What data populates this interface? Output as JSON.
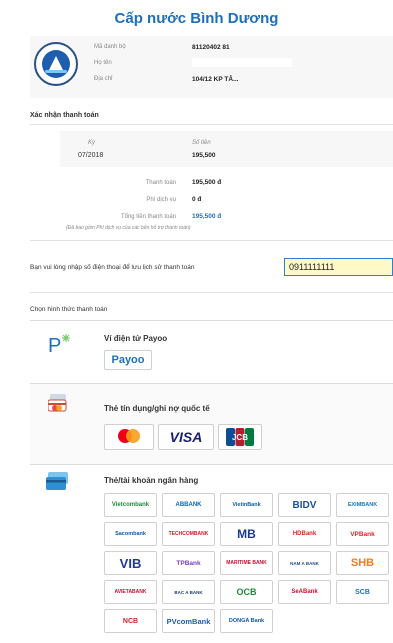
{
  "header": {
    "title": "Cấp nước Bình Dương"
  },
  "customer": {
    "code_label": "Mã danh bộ",
    "code_value": "81120402 81",
    "name_label": "Họ tên",
    "name_value": "",
    "address_label": "Địa chỉ",
    "address_value": "104/12 KP TÂ..."
  },
  "confirm": {
    "heading": "Xác nhận thanh toán",
    "period_label": "Kỳ",
    "period_value": "07/2018",
    "amount_label": "Số tiền",
    "amount_value": "195,500",
    "payment_label": "Thanh toán",
    "payment_value": "195,500 đ",
    "fee_label": "Phí dịch vụ",
    "fee_value": "0 đ",
    "total_label": "Tổng tiền thanh toán",
    "total_value": "195,500 đ",
    "note": "(Đã bao gồm Phí dịch vụ của các bên hỗ trợ thanh toán)"
  },
  "phone": {
    "prompt": "Bạn vui lòng nhập số điện thoại để lưu lịch sử thanh toán",
    "value": "0911111111"
  },
  "methods": {
    "heading": "Chọn hình thức thanh toán",
    "ewallet": {
      "title": "Ví điện tử Payoo",
      "tile": "Payoo"
    },
    "card": {
      "title": "Thẻ tín dụng/ghi nợ quốc tế",
      "tiles": [
        "mastercard",
        "VISA",
        "JCB"
      ]
    },
    "bank": {
      "title": "Thẻ/tài khoản ngân hàng",
      "tiles": [
        "Vietcombank",
        "ABBANK",
        "VietinBank",
        "BIDV",
        "EXIMBANK",
        "Sacombank",
        "TECHCOMBANK",
        "MB",
        "HDBank",
        "VPBank",
        "VIB",
        "TPBank",
        "MARITIME BANK",
        "NAM A BANK",
        "SHB",
        "AVIETABANK",
        "BAC A BANK",
        "OCB",
        "SeABank",
        "SCB",
        "NCB",
        "PVcomBank",
        "DONGA Bank"
      ]
    }
  },
  "colors": {
    "brand_blue": "#1f6fb8",
    "input_highlight": "#fff9c8",
    "mastercard_red": "#eb001b",
    "mastercard_orange": "#f79e1b",
    "visa_blue": "#1a1f71"
  },
  "icons": [
    "water-logo-icon",
    "payoo-icon",
    "credit-card-icon",
    "bank-card-icon"
  ]
}
